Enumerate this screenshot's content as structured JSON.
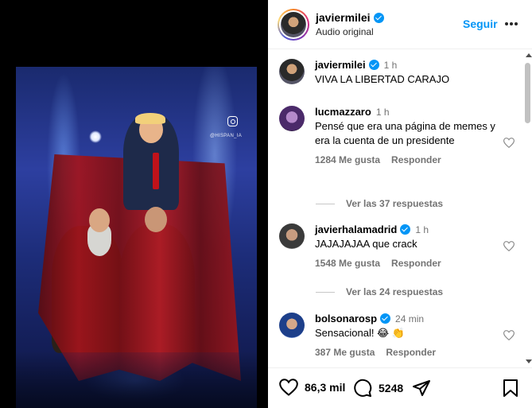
{
  "header": {
    "username": "javiermilei",
    "subtitle": "Audio original",
    "follow_label": "Seguir",
    "more_label": "..."
  },
  "media": {
    "watermark": "@HISPAN_IA"
  },
  "caption": {
    "username": "javiermilei",
    "time": "1 h",
    "text": "VIVA LA LIBERTAD CARAJO"
  },
  "comments": [
    {
      "username": "lucmazzaro",
      "time": "1 h",
      "text": "Pensé que era una página de memes y era la cuenta de un presidente",
      "likes": "1284 Me gusta",
      "reply": "Responder",
      "replies": "Ver las 37 respuestas",
      "verified": false
    },
    {
      "username": "javierhalamadrid",
      "time": "1 h",
      "text": "JAJAJAJAA que crack",
      "likes": "1548 Me gusta",
      "reply": "Responder",
      "replies": "Ver las 24 respuestas",
      "verified": true
    },
    {
      "username": "bolsonarosp",
      "time": "24 min",
      "text": "Sensacional! 😂 👏",
      "likes": "387 Me gusta",
      "reply": "Responder",
      "verified": true
    }
  ],
  "actions": {
    "likes_count": "86,3 mil",
    "comments_count": "5248"
  },
  "colors": {
    "accent": "#0095f6",
    "muted": "#737373"
  }
}
